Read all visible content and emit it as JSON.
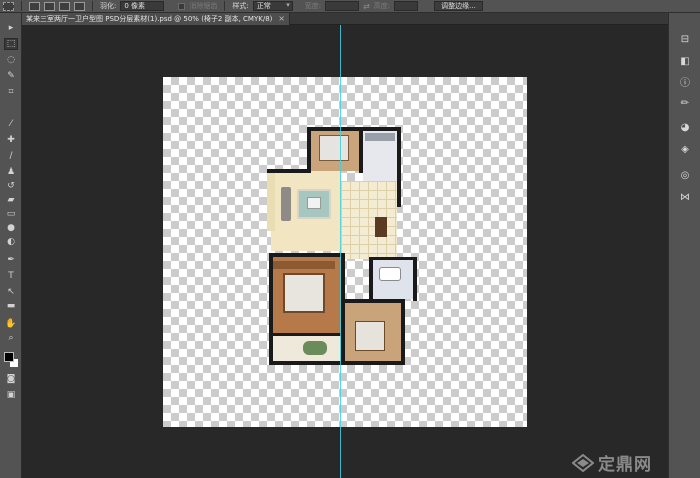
{
  "options_bar": {
    "feather_label": "羽化:",
    "feather_value": "0 像素",
    "antialias_label": "消除锯齿",
    "style_label": "样式:",
    "style_value": "正常",
    "width_label": "宽度:",
    "height_label": "高度:",
    "refine_edge_button": "调整边缘..."
  },
  "document_tab": {
    "title": "某来三室两厅一卫户型图 PSD分层素材(1).psd @ 50% (椅子2 副本, CMYK/8)",
    "close_glyph": "×"
  },
  "toolbar": {
    "tools": [
      {
        "name": "move-tool",
        "glyph": "▸"
      },
      {
        "name": "marquee-tool",
        "glyph": "⬚"
      },
      {
        "name": "lasso-tool",
        "glyph": "◌"
      },
      {
        "name": "quick-select-tool",
        "glyph": "✎"
      },
      {
        "name": "crop-tool",
        "glyph": "⌗"
      },
      {
        "name": "eyedropper-tool",
        "glyph": "⁄"
      },
      {
        "name": "healing-brush-tool",
        "glyph": "✚"
      },
      {
        "name": "brush-tool",
        "glyph": "∕"
      },
      {
        "name": "clone-stamp-tool",
        "glyph": "♟"
      },
      {
        "name": "history-brush-tool",
        "glyph": "↺"
      },
      {
        "name": "eraser-tool",
        "glyph": "▰"
      },
      {
        "name": "gradient-tool",
        "glyph": "▭"
      },
      {
        "name": "blur-tool",
        "glyph": "●"
      },
      {
        "name": "dodge-tool",
        "glyph": "◐"
      },
      {
        "name": "pen-tool",
        "glyph": "✒"
      },
      {
        "name": "type-tool",
        "glyph": "T"
      },
      {
        "name": "path-select-tool",
        "glyph": "↖"
      },
      {
        "name": "rectangle-tool",
        "glyph": "▬"
      },
      {
        "name": "hand-tool",
        "glyph": "✋"
      },
      {
        "name": "zoom-tool",
        "glyph": "⌕"
      }
    ],
    "quick_mask_glyph": "◙",
    "screen_mode_glyph": "▣"
  },
  "panels": {
    "icons": [
      {
        "name": "history-panel-icon",
        "glyph": "⊟"
      },
      {
        "name": "adjustments-panel-icon",
        "glyph": "◧"
      },
      {
        "name": "info-panel-icon",
        "glyph": "ⓘ"
      },
      {
        "name": "brush-panel-icon",
        "glyph": "✏"
      },
      {
        "name": "color-panel-icon",
        "glyph": "◕"
      },
      {
        "name": "layers-panel-icon",
        "glyph": "◈"
      },
      {
        "name": "channels-panel-icon",
        "glyph": "◎"
      },
      {
        "name": "paths-panel-icon",
        "glyph": "⋈"
      }
    ]
  },
  "watermark": {
    "text": "定鼎网"
  },
  "colors": {
    "canvas_guide": "#3fd0e0",
    "floor_tile": "#f2e6c2",
    "wood_floor": "#b5794a",
    "bedroom_floor": "#c9a37a",
    "kitchen_floor": "#e8e8ee",
    "wall": "#1a1a1a"
  }
}
